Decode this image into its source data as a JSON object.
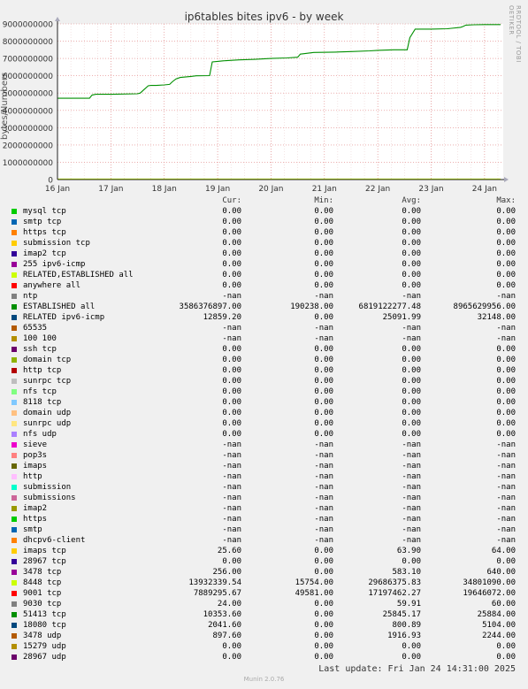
{
  "title": "ip6tables bites ipv6 - by week",
  "side_credit": "RRDTOOL / TOBI OETIKER",
  "ylabel": "bytes/Numbers",
  "headers": {
    "cur": "Cur:",
    "min": "Min:",
    "avg": "Avg:",
    "max": "Max:"
  },
  "legend": [
    {
      "name": "mysql tcp",
      "color": "#00cc00",
      "cur": "0.00",
      "min": "0.00",
      "avg": "0.00",
      "max": "0.00"
    },
    {
      "name": "smtp tcp",
      "color": "#0066b3",
      "cur": "0.00",
      "min": "0.00",
      "avg": "0.00",
      "max": "0.00"
    },
    {
      "name": "https tcp",
      "color": "#ff8000",
      "cur": "0.00",
      "min": "0.00",
      "avg": "0.00",
      "max": "0.00"
    },
    {
      "name": "submission tcp",
      "color": "#ffcc00",
      "cur": "0.00",
      "min": "0.00",
      "avg": "0.00",
      "max": "0.00"
    },
    {
      "name": "imap2 tcp",
      "color": "#330099",
      "cur": "0.00",
      "min": "0.00",
      "avg": "0.00",
      "max": "0.00"
    },
    {
      "name": "255 ipv6-icmp",
      "color": "#990099",
      "cur": "0.00",
      "min": "0.00",
      "avg": "0.00",
      "max": "0.00"
    },
    {
      "name": "RELATED,ESTABLISHED all",
      "color": "#ccff00",
      "cur": "0.00",
      "min": "0.00",
      "avg": "0.00",
      "max": "0.00"
    },
    {
      "name": "anywhere all",
      "color": "#ff0000",
      "cur": "0.00",
      "min": "0.00",
      "avg": "0.00",
      "max": "0.00"
    },
    {
      "name": "ntp",
      "color": "#808080",
      "cur": "-nan",
      "min": "-nan",
      "avg": "-nan",
      "max": "-nan"
    },
    {
      "name": "ESTABLISHED all",
      "color": "#008f00",
      "cur": "3586376897.00",
      "min": "190238.00",
      "avg": "6819122277.48",
      "max": "8965629956.00"
    },
    {
      "name": "RELATED ipv6-icmp",
      "color": "#00487d",
      "cur": "12859.20",
      "min": "0.00",
      "avg": "25091.99",
      "max": "32148.00"
    },
    {
      "name": "65535",
      "color": "#b35a00",
      "cur": "-nan",
      "min": "-nan",
      "avg": "-nan",
      "max": "-nan"
    },
    {
      "name": "100 100",
      "color": "#b38f00",
      "cur": "-nan",
      "min": "-nan",
      "avg": "-nan",
      "max": "-nan"
    },
    {
      "name": "ssh tcp",
      "color": "#6b006b",
      "cur": "0.00",
      "min": "0.00",
      "avg": "0.00",
      "max": "0.00"
    },
    {
      "name": "domain tcp",
      "color": "#8fb300",
      "cur": "0.00",
      "min": "0.00",
      "avg": "0.00",
      "max": "0.00"
    },
    {
      "name": "http tcp",
      "color": "#b30000",
      "cur": "0.00",
      "min": "0.00",
      "avg": "0.00",
      "max": "0.00"
    },
    {
      "name": "sunrpc tcp",
      "color": "#bebebe",
      "cur": "0.00",
      "min": "0.00",
      "avg": "0.00",
      "max": "0.00"
    },
    {
      "name": "nfs tcp",
      "color": "#80ff80",
      "cur": "0.00",
      "min": "0.00",
      "avg": "0.00",
      "max": "0.00"
    },
    {
      "name": "8118 tcp",
      "color": "#80c9ff",
      "cur": "0.00",
      "min": "0.00",
      "avg": "0.00",
      "max": "0.00"
    },
    {
      "name": "domain udp",
      "color": "#ffc080",
      "cur": "0.00",
      "min": "0.00",
      "avg": "0.00",
      "max": "0.00"
    },
    {
      "name": "sunrpc udp",
      "color": "#ffe680",
      "cur": "0.00",
      "min": "0.00",
      "avg": "0.00",
      "max": "0.00"
    },
    {
      "name": "nfs udp",
      "color": "#aa80ff",
      "cur": "0.00",
      "min": "0.00",
      "avg": "0.00",
      "max": "0.00"
    },
    {
      "name": "sieve",
      "color": "#ee00cc",
      "cur": "-nan",
      "min": "-nan",
      "avg": "-nan",
      "max": "-nan"
    },
    {
      "name": "pop3s",
      "color": "#ff8080",
      "cur": "-nan",
      "min": "-nan",
      "avg": "-nan",
      "max": "-nan"
    },
    {
      "name": "imaps",
      "color": "#666600",
      "cur": "-nan",
      "min": "-nan",
      "avg": "-nan",
      "max": "-nan"
    },
    {
      "name": "http",
      "color": "#ffbfff",
      "cur": "-nan",
      "min": "-nan",
      "avg": "-nan",
      "max": "-nan"
    },
    {
      "name": "submission",
      "color": "#00ffcc",
      "cur": "-nan",
      "min": "-nan",
      "avg": "-nan",
      "max": "-nan"
    },
    {
      "name": "submissions",
      "color": "#cc6699",
      "cur": "-nan",
      "min": "-nan",
      "avg": "-nan",
      "max": "-nan"
    },
    {
      "name": "imap2",
      "color": "#999900",
      "cur": "-nan",
      "min": "-nan",
      "avg": "-nan",
      "max": "-nan"
    },
    {
      "name": "https",
      "color": "#00cc00",
      "cur": "-nan",
      "min": "-nan",
      "avg": "-nan",
      "max": "-nan"
    },
    {
      "name": "smtp",
      "color": "#0066b3",
      "cur": "-nan",
      "min": "-nan",
      "avg": "-nan",
      "max": "-nan"
    },
    {
      "name": "dhcpv6-client",
      "color": "#ff8000",
      "cur": "-nan",
      "min": "-nan",
      "avg": "-nan",
      "max": "-nan"
    },
    {
      "name": "imaps tcp",
      "color": "#ffcc00",
      "cur": "25.60",
      "min": "0.00",
      "avg": "63.90",
      "max": "64.00"
    },
    {
      "name": "28967 tcp",
      "color": "#330099",
      "cur": "0.00",
      "min": "0.00",
      "avg": "0.00",
      "max": "0.00"
    },
    {
      "name": "3478 tcp",
      "color": "#990099",
      "cur": "256.00",
      "min": "0.00",
      "avg": "583.10",
      "max": "640.00"
    },
    {
      "name": "8448 tcp",
      "color": "#ccff00",
      "cur": "13932339.54",
      "min": "15754.00",
      "avg": "29686375.83",
      "max": "34801090.00"
    },
    {
      "name": "9001 tcp",
      "color": "#ff0000",
      "cur": "7889295.67",
      "min": "49581.00",
      "avg": "17197462.27",
      "max": "19646072.00"
    },
    {
      "name": "9030 tcp",
      "color": "#808080",
      "cur": "24.00",
      "min": "0.00",
      "avg": "59.91",
      "max": "60.00"
    },
    {
      "name": "51413 tcp",
      "color": "#008f00",
      "cur": "10353.60",
      "min": "0.00",
      "avg": "25845.17",
      "max": "25884.00"
    },
    {
      "name": "18080 tcp",
      "color": "#00487d",
      "cur": "2041.60",
      "min": "0.00",
      "avg": "800.89",
      "max": "5104.00"
    },
    {
      "name": "3478 udp",
      "color": "#b35a00",
      "cur": "897.60",
      "min": "0.00",
      "avg": "1916.93",
      "max": "2244.00"
    },
    {
      "name": "15279 udp",
      "color": "#b38f00",
      "cur": "0.00",
      "min": "0.00",
      "avg": "0.00",
      "max": "0.00"
    },
    {
      "name": "28967 udp",
      "color": "#6b006b",
      "cur": "0.00",
      "min": "0.00",
      "avg": "0.00",
      "max": "0.00"
    }
  ],
  "last_update": "Last update: Fri Jan 24 14:31:00 2025",
  "footer": "Munin 2.0.76",
  "chart_data": {
    "type": "line",
    "title": "ip6tables bites ipv6 - by week",
    "ylabel": "bytes/Numbers",
    "x_ticks": [
      "16 Jan",
      "17 Jan",
      "18 Jan",
      "19 Jan",
      "20 Jan",
      "21 Jan",
      "22 Jan",
      "23 Jan",
      "24 Jan"
    ],
    "xlim": [
      0,
      8.35
    ],
    "ylim": [
      0,
      9000000000
    ],
    "y_ticks": [
      0,
      1000000000,
      2000000000,
      3000000000,
      4000000000,
      5000000000,
      6000000000,
      7000000000,
      8000000000,
      9000000000
    ],
    "y_tick_labels": [
      "0",
      "1000000000",
      "2000000000",
      "3000000000",
      "4000000000",
      "5000000000",
      "6000000000",
      "7000000000",
      "8000000000",
      "9000000000"
    ],
    "grid": true,
    "series": [
      {
        "name": "ESTABLISHED all",
        "color": "#008f00",
        "x": [
          0,
          0.6,
          0.62,
          0.65,
          0.72,
          1.0,
          1.5,
          1.55,
          1.62,
          1.7,
          1.75,
          1.85,
          2.0,
          2.1,
          2.15,
          2.22,
          2.3,
          2.5,
          2.6,
          2.85,
          2.9,
          3.0,
          3.1,
          3.4,
          3.7,
          4.0,
          4.3,
          4.5,
          4.55,
          4.6,
          4.75,
          4.8,
          5.2,
          5.5,
          5.85,
          6.0,
          6.3,
          6.55,
          6.6,
          6.7,
          7.0,
          7.3,
          7.55,
          7.6,
          7.65,
          7.8,
          8.0,
          8.3
        ],
        "y": [
          4700000000,
          4700000000,
          4780000000,
          4890000000,
          4930000000,
          4930000000,
          4960000000,
          5000000000,
          5200000000,
          5420000000,
          5440000000,
          5440000000,
          5470000000,
          5500000000,
          5650000000,
          5820000000,
          5900000000,
          5960000000,
          6000000000,
          6010000000,
          6800000000,
          6830000000,
          6860000000,
          6920000000,
          6950000000,
          7000000000,
          7030000000,
          7070000000,
          7250000000,
          7270000000,
          7330000000,
          7350000000,
          7370000000,
          7400000000,
          7440000000,
          7470000000,
          7500000000,
          7500000000,
          8200000000,
          8700000000,
          8700000000,
          8720000000,
          8800000000,
          8850000000,
          8930000000,
          8950000000,
          8960000000,
          8960000000
        ]
      },
      {
        "name": "8448 tcp",
        "color": "#ccff00",
        "x": [
          0,
          8.3
        ],
        "y": [
          30000000,
          30000000
        ]
      }
    ]
  }
}
